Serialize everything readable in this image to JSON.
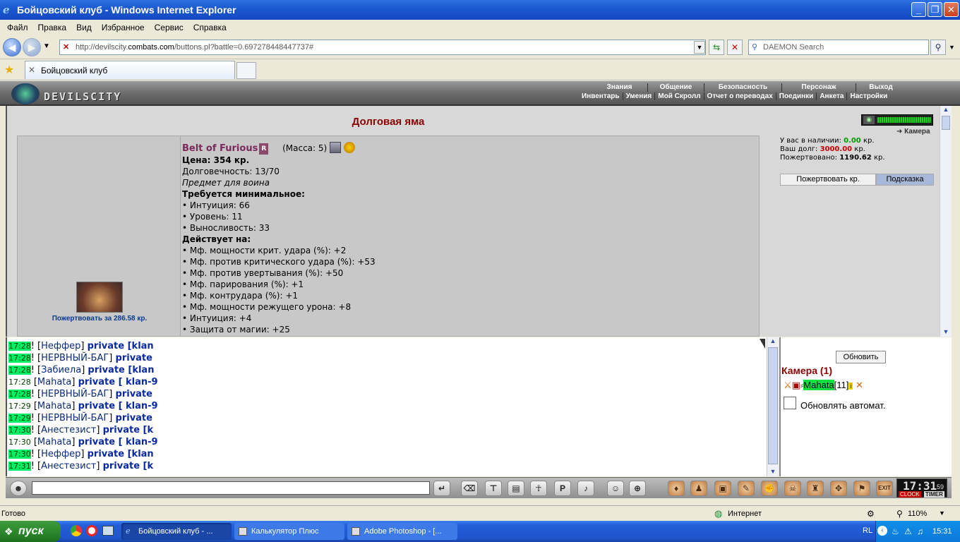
{
  "window": {
    "title": "Бойцовский клуб - Windows Internet Explorer",
    "minimize": "_",
    "maximize": "❐",
    "close": "✕"
  },
  "menu": [
    "Файл",
    "Правка",
    "Вид",
    "Избранное",
    "Сервис",
    "Справка"
  ],
  "address": {
    "prefix": "http://devilscity.",
    "domain": "combats.com",
    "suffix": "/buttons.pl?battle=0.697278448447737#"
  },
  "search": {
    "placeholder": "DAEMON Search"
  },
  "tab": {
    "label": "Бойцовский клуб"
  },
  "game": {
    "logo": "DEVILSCITY",
    "nav_top": [
      "Знания",
      "Общение",
      "Безопасность",
      "Персонаж",
      "Выход"
    ],
    "nav_bottom": [
      "Инвентарь",
      "Умения",
      "Мой Скролл",
      "Отчет о переводах",
      "Поединки",
      "Анкета",
      "Настройки"
    ],
    "page_title": "Долговая яма",
    "item": {
      "name": "Belt of Furious",
      "badge": "R",
      "mass": "(Масса: 5)",
      "price": "Цена: 354 кр.",
      "durability": "Долговечность: 13/70",
      "class": "Предмет для воина",
      "req_header": "Требуется минимальное:",
      "requirements": [
        "• Интуиция: 66",
        "• Уровень: 11",
        "• Выносливость: 33"
      ],
      "effects_header": "Действует на:",
      "effects": [
        "• Мф. мощности крит. удара (%): +2",
        "• Мф. против критического удара (%): +53",
        "• Мф. против увертывания (%): +50",
        "• Мф. парирования (%): +1",
        "• Мф. контрудара (%): +1",
        "• Мф. мощности режущего урона: +8",
        "• Интуиция: +4",
        "• Защита от магии: +25"
      ],
      "donate": "Пожертвовать за 286.58 кр."
    },
    "camera_link": "Камера",
    "balance": {
      "have_label": "У вас в наличии:",
      "have": "0.00",
      "debt_label": "Ваш долг:",
      "debt": "3000.00",
      "donated_label": "Пожертвовано:",
      "donated": "1190.62",
      "unit": "кр."
    },
    "buttons": {
      "donate": "Пожертвовать кр.",
      "hint": "Подсказка"
    }
  },
  "chat": {
    "messages": [
      {
        "time": "17:28",
        "green": true,
        "sep": "!",
        "name": "Неффер",
        "tag": "private [klan"
      },
      {
        "time": "17:28",
        "green": true,
        "sep": "!",
        "name": "НЕРВНЫЙ-БАГ",
        "tag": "private"
      },
      {
        "time": "17:28",
        "green": true,
        "sep": "!",
        "name": "Забиела",
        "tag": "private [klan"
      },
      {
        "time": "17:28",
        "green": false,
        "sep": "",
        "name": "Mahata",
        "tag": "private [ klan-9"
      },
      {
        "time": "17:28",
        "green": true,
        "sep": "!",
        "name": "НЕРВНЫЙ-БАГ",
        "tag": "private"
      },
      {
        "time": "17:29",
        "green": false,
        "sep": "",
        "name": "Mahata",
        "tag": "private [ klan-9"
      },
      {
        "time": "17:29",
        "green": true,
        "sep": "!",
        "name": "НЕРВНЫЙ-БАГ",
        "tag": "private"
      },
      {
        "time": "17:30",
        "green": true,
        "sep": "!",
        "name": "Анестезист",
        "tag": "private [k"
      },
      {
        "time": "17:30",
        "green": false,
        "sep": "",
        "name": "Mahata",
        "tag": "private [ klan-9"
      },
      {
        "time": "17:30",
        "green": true,
        "sep": "!",
        "name": "Неффер",
        "tag": "private [klan"
      },
      {
        "time": "17:31",
        "green": true,
        "sep": "!",
        "name": "Анестезист",
        "tag": "private [k"
      }
    ]
  },
  "room": {
    "refresh": "Обновить",
    "title": "Камера (1)",
    "user": "Mahata",
    "level": "[11]",
    "auto": "Обновлять автомат."
  },
  "clock": {
    "time": "17:31",
    "seconds": "59",
    "clock_label": "CLOCK",
    "timer_label": "TIMER"
  },
  "status": {
    "left": "Готово",
    "zone": "Интернет",
    "zoom": "110%"
  },
  "taskbar": {
    "start": "пуск",
    "tasks": [
      "Бойцовский клуб - ...",
      "Калькулятор Плюс",
      "Adobe Photoshop - [..."
    ],
    "lang": "RL",
    "time": "15:31"
  }
}
